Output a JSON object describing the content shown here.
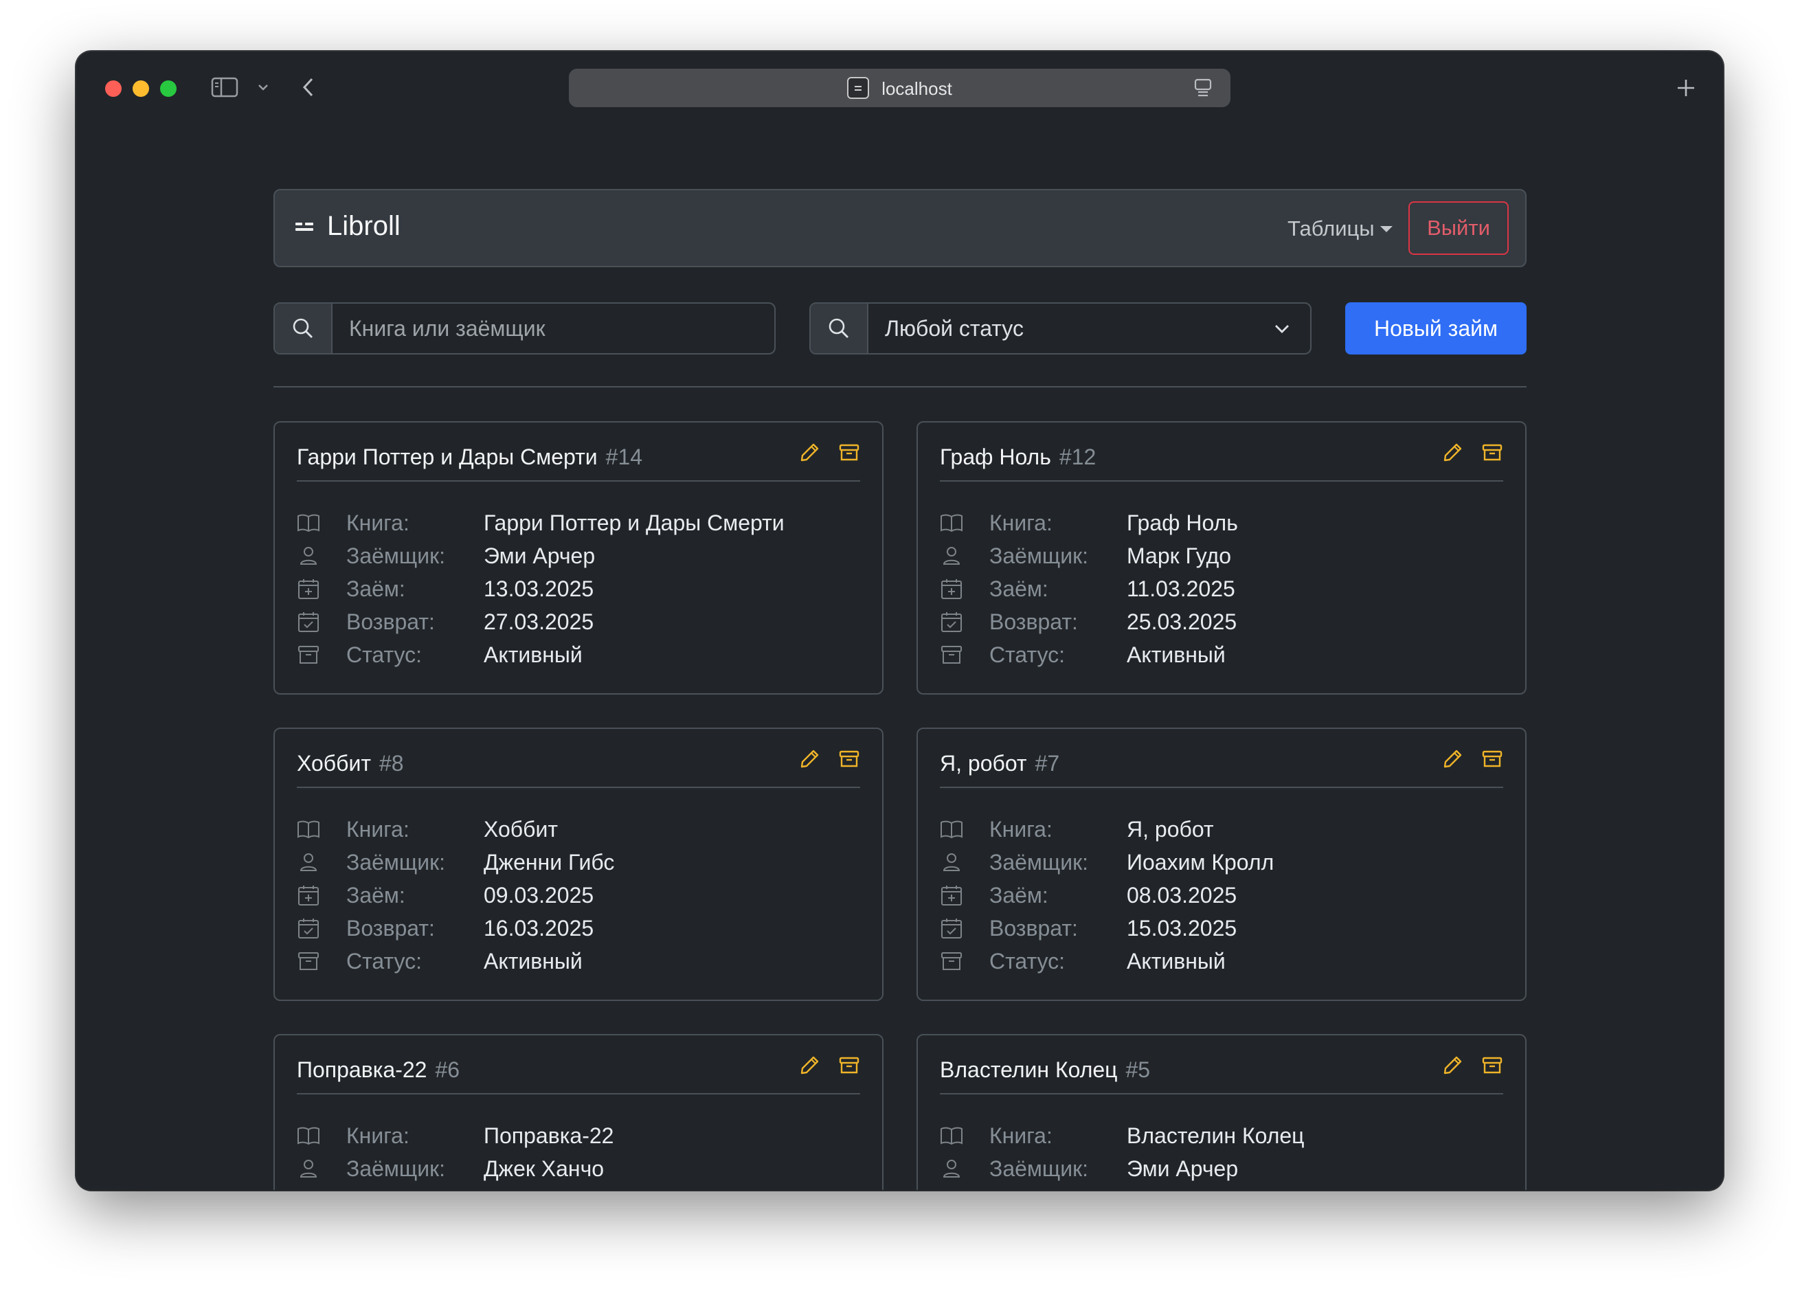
{
  "browser": {
    "url": "localhost"
  },
  "navbar": {
    "brand": "Libroll",
    "tables_label": "Таблицы",
    "logout_label": "Выйти"
  },
  "filters": {
    "search_placeholder": "Книга или заёмщик",
    "status_value": "Любой статус",
    "new_loan_label": "Новый займ"
  },
  "labels": {
    "book": "Книга:",
    "borrower": "Заёмщик:",
    "loan": "Заём:",
    "return": "Возврат:",
    "status": "Статус:"
  },
  "colors": {
    "primary": "#2f6ef5",
    "danger": "#dc3545",
    "warning": "#f0b429",
    "background": "#212529",
    "navbar": "#343a40"
  },
  "cards": [
    {
      "title": "Гарри Поттер и Дары Смерти",
      "id": "#14",
      "book": "Гарри Поттер и Дары Смерти",
      "borrower": "Эми Арчер",
      "loan_date": "13.03.2025",
      "return_date": "27.03.2025",
      "status": "Активный"
    },
    {
      "title": "Граф Ноль",
      "id": "#12",
      "book": "Граф Ноль",
      "borrower": "Марк Гудо",
      "loan_date": "11.03.2025",
      "return_date": "25.03.2025",
      "status": "Активный"
    },
    {
      "title": "Хоббит",
      "id": "#8",
      "book": "Хоббит",
      "borrower": "Дженни Гибс",
      "loan_date": "09.03.2025",
      "return_date": "16.03.2025",
      "status": "Активный"
    },
    {
      "title": "Я, робот",
      "id": "#7",
      "book": "Я, робот",
      "borrower": "Иоахим Кролл",
      "loan_date": "08.03.2025",
      "return_date": "15.03.2025",
      "status": "Активный"
    },
    {
      "title": "Поправка-22",
      "id": "#6",
      "book": "Поправка-22",
      "borrower": "Джек Ханчо"
    },
    {
      "title": "Властелин Колец",
      "id": "#5",
      "book": "Властелин Колец",
      "borrower": "Эми Арчер"
    }
  ]
}
